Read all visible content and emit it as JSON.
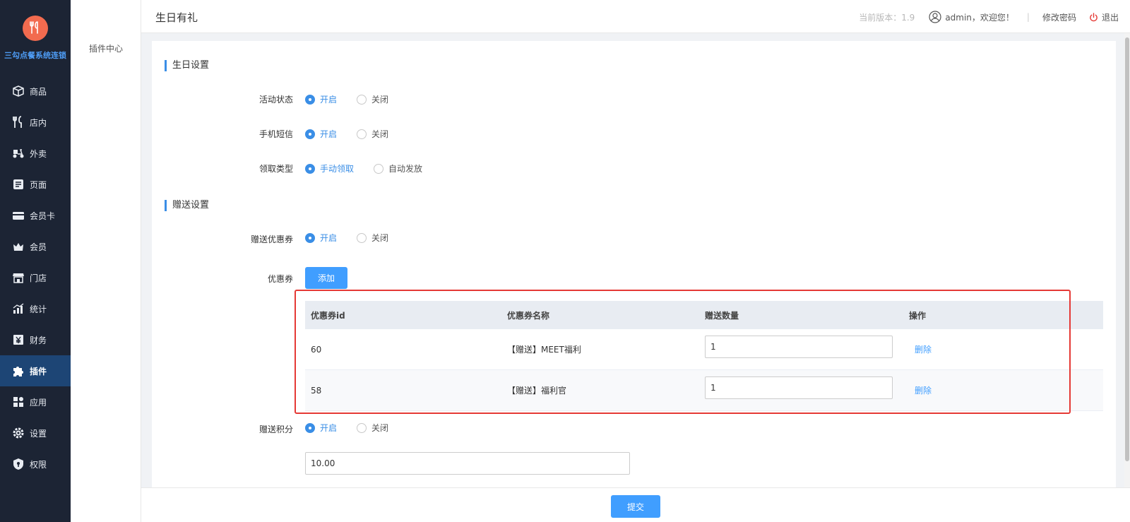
{
  "app": {
    "brand": "三勾点餐系统连锁",
    "logo_icon": "utensils-icon",
    "accent_color": "#409eff",
    "sidebar_bg": "#1c2434"
  },
  "nav": {
    "items": [
      {
        "label": "商品",
        "icon": "box-icon"
      },
      {
        "label": "店内",
        "icon": "utensils-icon"
      },
      {
        "label": "外卖",
        "icon": "scooter-icon"
      },
      {
        "label": "页面",
        "icon": "page-icon"
      },
      {
        "label": "会员卡",
        "icon": "card-icon"
      },
      {
        "label": "会员",
        "icon": "crown-icon"
      },
      {
        "label": "门店",
        "icon": "store-icon"
      },
      {
        "label": "统计",
        "icon": "chart-icon"
      },
      {
        "label": "财务",
        "icon": "yen-icon"
      },
      {
        "label": "插件",
        "icon": "puzzle-icon",
        "active": true
      },
      {
        "label": "应用",
        "icon": "apps-icon"
      },
      {
        "label": "设置",
        "icon": "gear-icon"
      },
      {
        "label": "权限",
        "icon": "shield-icon"
      }
    ]
  },
  "subnav": {
    "item": "插件中心"
  },
  "header": {
    "title": "生日有礼",
    "version": "当前版本：1.9",
    "user": "admin，欢迎您！",
    "separator": "|",
    "change_password": "修改密码",
    "logout": "退出"
  },
  "birthday_settings": {
    "title": "生日设置",
    "activity_status": {
      "label": "活动状态",
      "options": [
        "开启",
        "关闭"
      ],
      "selected": "开启"
    },
    "sms": {
      "label": "手机短信",
      "options": [
        "开启",
        "关闭"
      ],
      "selected": "开启"
    },
    "claim_type": {
      "label": "领取类型",
      "options": [
        "手动领取",
        "自动发放"
      ],
      "selected": "手动领取"
    }
  },
  "gift_settings": {
    "title": "赠送设置",
    "gift_coupon": {
      "label": "赠送优惠券",
      "options": [
        "开启",
        "关闭"
      ],
      "selected": "开启"
    },
    "coupon_label": "优惠券",
    "add_button": "添加",
    "table": {
      "headers": [
        "优惠券id",
        "优惠券名称",
        "赠送数量",
        "操作"
      ],
      "rows": [
        {
          "id": "60",
          "name": "【赠送】MEET福利",
          "qty": "1",
          "action": "删除"
        },
        {
          "id": "58",
          "name": "【赠送】福利官",
          "qty": "1",
          "action": "删除"
        }
      ]
    },
    "gift_points": {
      "label": "赠送积分",
      "options": [
        "开启",
        "关闭"
      ],
      "selected": "开启"
    },
    "points_value": "10.00"
  },
  "footer": {
    "submit": "提交"
  }
}
